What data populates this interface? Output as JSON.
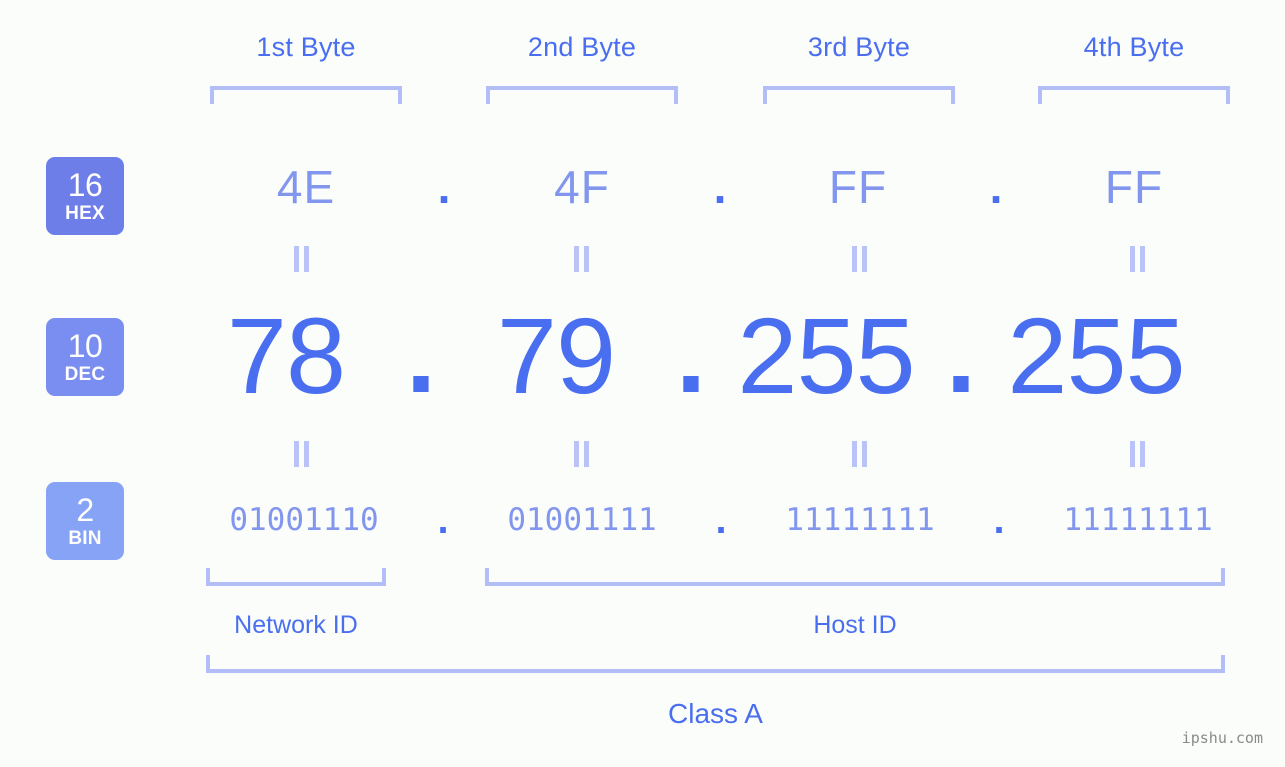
{
  "background_color": "#fbfdfa",
  "accent_color": "#4a6ef0",
  "light_accent_color": "#8296ee",
  "bracket_color": "#b3bdf7",
  "byte_headers": [
    {
      "label": "1st Byte"
    },
    {
      "label": "2nd Byte"
    },
    {
      "label": "3rd Byte"
    },
    {
      "label": "4th Byte"
    }
  ],
  "bases": {
    "hex": {
      "number": "16",
      "abbr": "HEX",
      "badge_color": "#6d7ee8"
    },
    "dec": {
      "number": "10",
      "abbr": "DEC",
      "badge_color": "#7a8ef1"
    },
    "bin": {
      "number": "2",
      "abbr": "BIN",
      "badge_color": "#86a3f5"
    }
  },
  "separator": ".",
  "equals_symbol": "=",
  "rows": {
    "hex": {
      "values": [
        "4E",
        "4F",
        "FF",
        "FF"
      ]
    },
    "dec": {
      "values": [
        "78",
        "79",
        "255",
        "255"
      ]
    },
    "bin": {
      "values": [
        "01001110",
        "01001111",
        "11111111",
        "11111111"
      ]
    }
  },
  "segments": {
    "network_id": "Network ID",
    "host_id": "Host ID"
  },
  "class_label": "Class A",
  "watermark": "ipshu.com"
}
